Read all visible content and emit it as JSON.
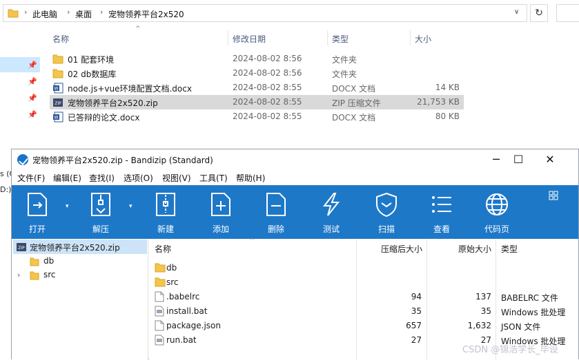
{
  "explorer": {
    "breadcrumb": [
      "此电脑",
      "桌面",
      "宠物领养平台2x520"
    ],
    "columns": {
      "name": "名称",
      "date": "修改日期",
      "type": "类型",
      "size": "大小"
    },
    "files": [
      {
        "name": "01  配套环境",
        "date": "2024-08-02 8:56",
        "type": "文件夹",
        "size": "",
        "icon": "folder-icon"
      },
      {
        "name": "02 db数据库",
        "date": "2024-08-02 8:56",
        "type": "文件夹",
        "size": "",
        "icon": "folder-icon"
      },
      {
        "name": "node.js+vue环境配置文档.docx",
        "date": "2024-08-02 8:55",
        "type": "DOCX 文档",
        "size": "14 KB",
        "icon": "word-doc-icon"
      },
      {
        "name": "宠物领养平台2x520.zip",
        "date": "2024-08-02 8:55",
        "type": "ZIP 压缩文件",
        "size": "21,753 KB",
        "icon": "zip-icon"
      },
      {
        "name": "已答辩的论文.docx",
        "date": "2024-08-02 8:55",
        "type": "DOCX 文档",
        "size": "80 KB",
        "icon": "word-doc-icon"
      }
    ],
    "left_fragments": [
      "s (C",
      "D:)"
    ]
  },
  "bandizip": {
    "title": "宠物领养平台2x520.zip - Bandizip (Standard)",
    "menu": [
      "文件(F)",
      "编辑(E)",
      "查找(I)",
      "选项(O)",
      "视图(V)",
      "工具(T)",
      "帮助(H)"
    ],
    "toolbar": [
      "打开",
      "解压",
      "新建",
      "添加",
      "删除",
      "测试",
      "扫描",
      "查看",
      "代码页"
    ],
    "tree": {
      "root": "宠物领养平台2x520.zip",
      "children": [
        "db",
        "src"
      ]
    },
    "list_columns": {
      "name": "名称",
      "compressed": "压缩后大小",
      "original": "原始大小",
      "type": "类型"
    },
    "entries": [
      {
        "name": "db",
        "compressed": "",
        "original": "",
        "type": "",
        "icon": "folder-icon"
      },
      {
        "name": "src",
        "compressed": "",
        "original": "",
        "type": "",
        "icon": "folder-icon"
      },
      {
        "name": ".babelrc",
        "compressed": "94",
        "original": "137",
        "type": "BABELRC 文件",
        "icon": "file-icon"
      },
      {
        "name": "install.bat",
        "compressed": "35",
        "original": "35",
        "type": "Windows 批处理",
        "icon": "bat-file-icon"
      },
      {
        "name": "package.json",
        "compressed": "657",
        "original": "1,632",
        "type": "JSON 文件",
        "icon": "file-icon"
      },
      {
        "name": "run.bat",
        "compressed": "27",
        "original": "27",
        "type": "Windows 批处理",
        "icon": "bat-file-icon"
      }
    ]
  },
  "watermark": "CSDN @锦浩学长_毕设",
  "colors": {
    "toolbar": "#1e78c8",
    "selection": "#cde3f7",
    "folder": "#f3c54a"
  }
}
